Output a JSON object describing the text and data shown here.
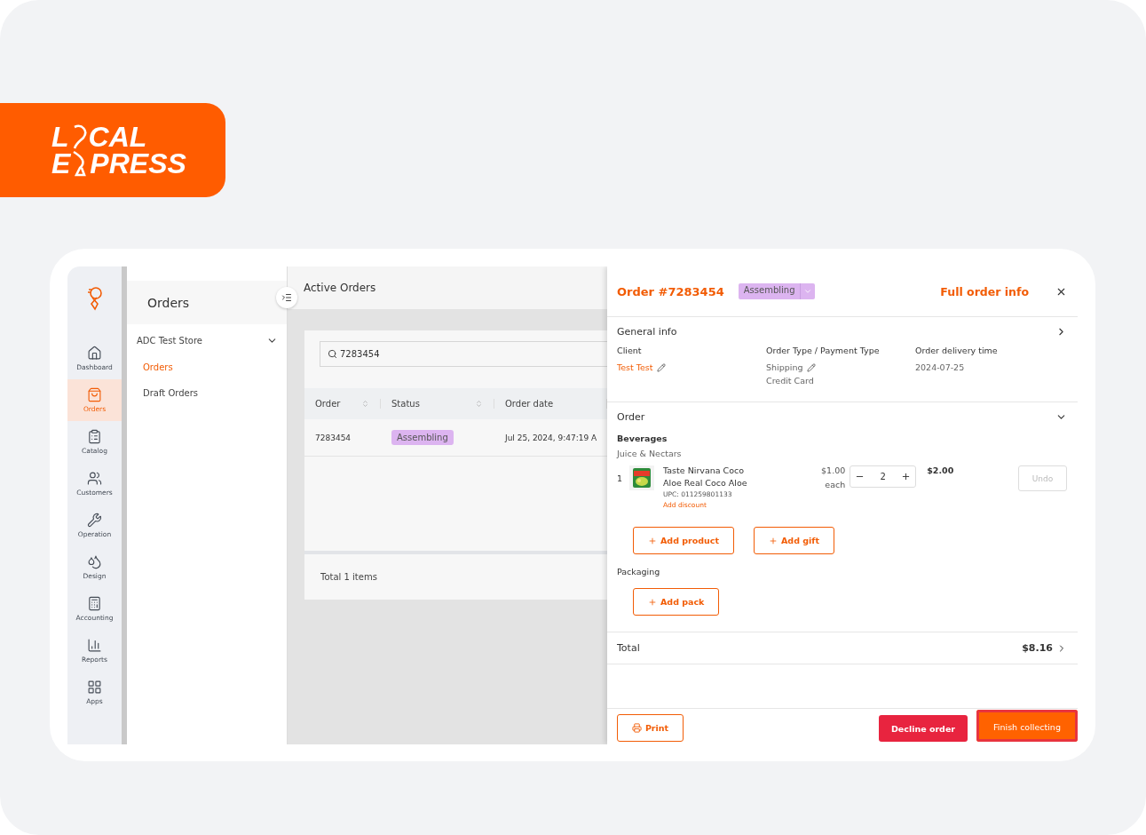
{
  "logo": {
    "line_1_start": "L",
    "line_1_end": "CAL",
    "line_2_start": "E",
    "line_2_end": "PRESS"
  },
  "rail": [
    {
      "label": "Dashboard",
      "selected": false
    },
    {
      "label": "Orders",
      "selected": true
    },
    {
      "label": "Catalog",
      "selected": false
    },
    {
      "label": "Customers",
      "selected": false
    },
    {
      "label": "Operation",
      "selected": false
    },
    {
      "label": "Design",
      "selected": false
    },
    {
      "label": "Accounting",
      "selected": false
    },
    {
      "label": "Reports",
      "selected": false
    },
    {
      "label": "Apps",
      "selected": false
    }
  ],
  "subnav": {
    "title": "Orders",
    "store": "ADC Test Store",
    "items": [
      {
        "label": "Orders",
        "selected": true
      },
      {
        "label": "Draft Orders",
        "selected": false
      }
    ]
  },
  "main": {
    "title": "Active Orders",
    "search": {
      "value": "7283454"
    },
    "columns": [
      {
        "label": "Order",
        "sortable": true
      },
      {
        "label": "Status",
        "sortable": true
      },
      {
        "label": "Order date",
        "sortable": false
      }
    ],
    "rows": [
      {
        "order": "7283454",
        "status": "Assembling",
        "date": "Jul 25, 2024, 9:47:19 A"
      }
    ],
    "total": "Total 1 items"
  },
  "drawer": {
    "title": "Order #7283454",
    "status": "Assembling",
    "full_info": "Full order info",
    "general": {
      "title": "General info",
      "fields": [
        {
          "label": "Client",
          "lines": [
            "Test Test"
          ],
          "link": true,
          "editable": true
        },
        {
          "label": "Order Type / Payment Type",
          "lines": [
            "Shipping",
            "Credit Card"
          ],
          "link": false,
          "editable": true
        },
        {
          "label": "Order delivery time",
          "lines": [
            "2024-07-25"
          ],
          "link": false,
          "editable": false
        }
      ]
    },
    "order": {
      "title": "Order",
      "category": "Beverages",
      "subcategory": "Juice & Nectars",
      "items": [
        {
          "index": "1",
          "name_lines": [
            "Taste Nirvana Coco",
            "Aloe Real Coco Aloe"
          ],
          "upc": "UPC: 011259801133",
          "discount": "Add discount",
          "price": "$1.00",
          "price_unit": "each",
          "quantity": "2",
          "total": "$2.00",
          "undo": "Undo"
        }
      ],
      "buttons": [
        "Add product",
        "Add gift"
      ],
      "packaging": "Packaging",
      "pack_button": "Add pack"
    },
    "total_label": "Total",
    "total_value": "$8.16",
    "footer": {
      "print": "Print",
      "decline": "Decline order",
      "finish": "Finish collecting",
      "finish_highlighted": true
    }
  }
}
